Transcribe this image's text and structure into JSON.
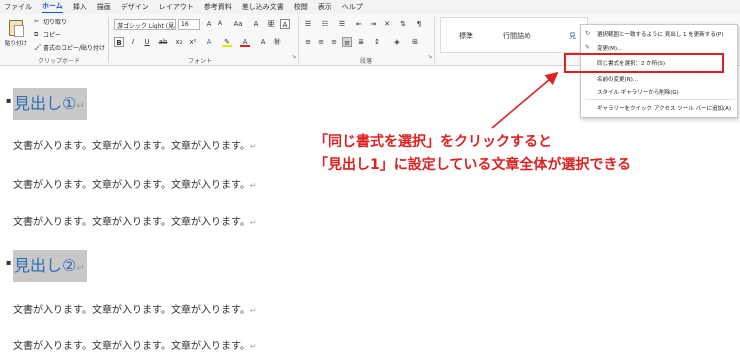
{
  "menubar": {
    "tabs": [
      "ファイル",
      "ホーム",
      "挿入",
      "描画",
      "デザイン",
      "レイアウト",
      "参考資料",
      "差し込み文書",
      "校閲",
      "表示",
      "ヘルプ"
    ],
    "active_index": 1
  },
  "ribbon": {
    "clipboard": {
      "paste_label": "貼り付け",
      "cut_label": "切り取り",
      "copy_label": "コピー",
      "format_painter_label": "書式のコピー/貼り付け",
      "group_label": "クリップボード"
    },
    "font": {
      "font_name": "游ゴシック Light (見出",
      "font_size": "16",
      "group_label": "フォント"
    },
    "paragraph": {
      "group_label": "段落"
    },
    "styles": {
      "items": [
        "標準",
        "行間詰め",
        "見"
      ]
    }
  },
  "context_menu": {
    "items": [
      "選択範囲と一致するように 見出し 1 を更新する(P)",
      "変更(M)...",
      "同じ書式を選択：2 か所(S)",
      "名前の変更(N)...",
      "スタイル ギャラリーから削除(G)",
      "ギャラリーをクイック アクセス ツール バーに追加(A)"
    ]
  },
  "document": {
    "heading1": "見出し①",
    "heading2": "見出し②",
    "body_text": "文書が入ります。文章が入ります。文章が入ります。",
    "para_mark": "↵"
  },
  "annotation": {
    "line1": "「同じ書式を選択」をクリックすると",
    "line2": "「見出し1」に設定している文章全体が選択できる"
  },
  "colors": {
    "accent_red": "#e02020",
    "heading_blue": "#2e6fb5",
    "ribbon_active": "#185abd"
  }
}
